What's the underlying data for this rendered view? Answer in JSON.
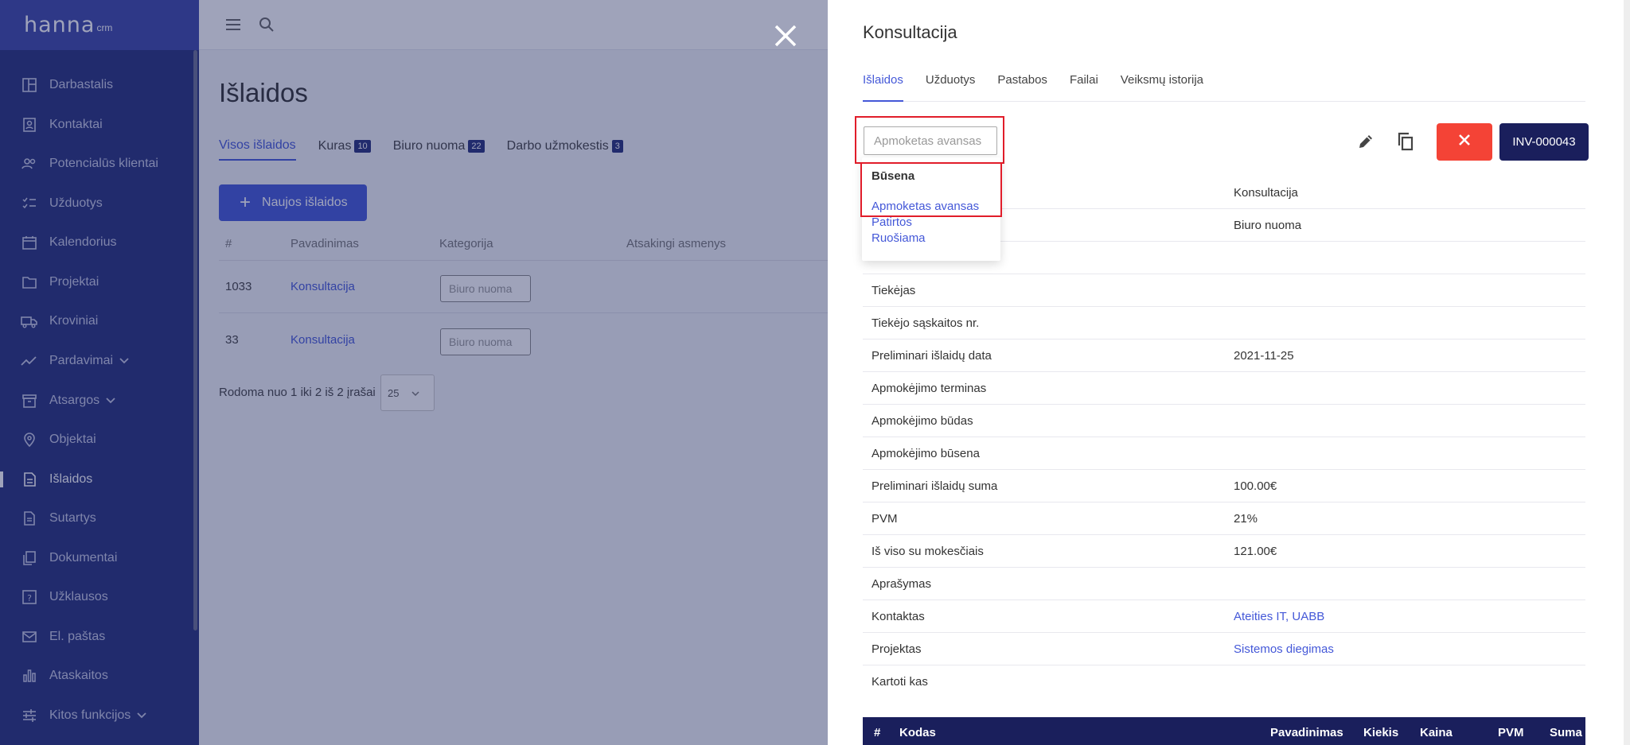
{
  "brand": {
    "name": "hanna",
    "suffix": "crm"
  },
  "sidebar": {
    "items": [
      {
        "label": "Darbastalis",
        "icon": "dashboard-icon"
      },
      {
        "label": "Kontaktai",
        "icon": "contacts-icon"
      },
      {
        "label": "Potencialūs klientai",
        "icon": "leads-icon"
      },
      {
        "label": "Užduotys",
        "icon": "tasks-icon"
      },
      {
        "label": "Kalendorius",
        "icon": "calendar-icon"
      },
      {
        "label": "Projektai",
        "icon": "folder-icon"
      },
      {
        "label": "Kroviniai",
        "icon": "truck-icon"
      },
      {
        "label": "Pardavimai",
        "icon": "trend-icon",
        "expandable": true
      },
      {
        "label": "Atsargos",
        "icon": "archive-icon",
        "expandable": true
      },
      {
        "label": "Objektai",
        "icon": "location-icon"
      },
      {
        "label": "Išlaidos",
        "icon": "expenses-icon",
        "active": true
      },
      {
        "label": "Sutartys",
        "icon": "contract-icon"
      },
      {
        "label": "Dokumentai",
        "icon": "documents-icon"
      },
      {
        "label": "Užklausos",
        "icon": "inquiry-icon"
      },
      {
        "label": "El. paštas",
        "icon": "mail-icon"
      },
      {
        "label": "Ataskaitos",
        "icon": "reports-icon"
      },
      {
        "label": "Kitos funkcijos",
        "icon": "settings-sliders-icon",
        "expandable": true
      }
    ]
  },
  "main": {
    "title": "Išlaidos",
    "tabs": [
      {
        "label": "Visos išlaidos",
        "active": true
      },
      {
        "label": "Kuras",
        "count": "10"
      },
      {
        "label": "Biuro nuoma",
        "count": "22"
      },
      {
        "label": "Darbo užmokestis",
        "count": "3"
      }
    ],
    "new_button": "Naujos išlaidos",
    "table": {
      "headers": [
        "#",
        "Pavadinimas",
        "Kategorija",
        "Atsakingi asmenys"
      ],
      "rows": [
        {
          "id": "1033",
          "name": "Konsultacija",
          "category": "Biuro nuoma"
        },
        {
          "id": "33",
          "name": "Konsultacija",
          "category": "Biuro nuoma"
        }
      ]
    },
    "pager": {
      "text": "Rodoma nuo 1 iki 2 iš 2 įrašai",
      "per_page": "25"
    }
  },
  "drawer": {
    "title": "Konsultacija",
    "tabs": [
      "Išlaidos",
      "Užduotys",
      "Pastabos",
      "Failai",
      "Veiksmų istorija"
    ],
    "status_input": {
      "placeholder": "Apmoketas avansas"
    },
    "status_dropdown": {
      "header": "Būsena",
      "options": [
        "Apmoketas avansas",
        "Patirtos",
        "Ruošiama"
      ]
    },
    "invoice_button": "INV-000043",
    "details": [
      {
        "label": "",
        "value": "Konsultacija"
      },
      {
        "label": "",
        "value": "Biuro nuoma"
      },
      {
        "label": "",
        "value": ""
      },
      {
        "label": "Tiekėjas",
        "value": ""
      },
      {
        "label": "Tiekėjo sąskaitos nr.",
        "value": ""
      },
      {
        "label": "Preliminari išlaidų data",
        "value": "2021-11-25"
      },
      {
        "label": "Apmokėjimo terminas",
        "value": ""
      },
      {
        "label": "Apmokėjimo būdas",
        "value": ""
      },
      {
        "label": "Apmokėjimo būsena",
        "value": ""
      },
      {
        "label": "Preliminari išlaidų suma",
        "value": "100.00€"
      },
      {
        "label": "PVM",
        "value": "21%"
      },
      {
        "label": "Iš viso su mokesčiais",
        "value": "121.00€"
      },
      {
        "label": "Aprašymas",
        "value": ""
      },
      {
        "label": "Kontaktas",
        "value": "Ateities IT, UABB",
        "link": true
      },
      {
        "label": "Projektas",
        "value": "Sistemos diegimas",
        "link": true
      },
      {
        "label": "Kartoti kas",
        "value": ""
      }
    ],
    "items_table_headers": [
      "#",
      "Kodas",
      "Pavadinimas",
      "Kiekis",
      "Kaina",
      "PVM",
      "Suma"
    ]
  },
  "colors": {
    "sidebar": "#27317a",
    "accent": "#4458d8",
    "danger": "#f44336",
    "dark_button": "#1a1f5c",
    "highlight_frame": "#e11d2a"
  }
}
